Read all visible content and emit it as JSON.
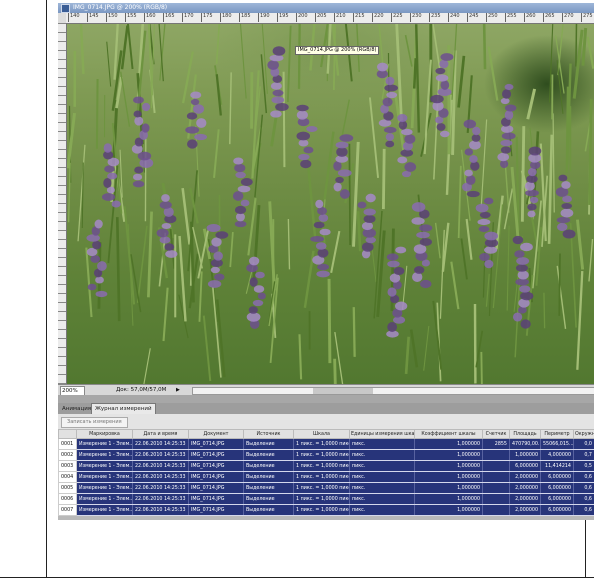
{
  "document": {
    "title": "IMG_0714.JPG @ 200% (RGB/8)",
    "tooltip": "IMG_0714.JPG @ 200% (RGB/8)",
    "ruler_ticks": [
      "140",
      "145",
      "150",
      "155",
      "160",
      "165",
      "170",
      "175",
      "180",
      "185",
      "190",
      "195",
      "200",
      "205",
      "210",
      "215",
      "220",
      "225",
      "230",
      "235",
      "240",
      "245",
      "250",
      "255",
      "260",
      "265",
      "270",
      "275"
    ]
  },
  "status_bar": {
    "zoom": "200%",
    "doc_info": "Док: 57,0M/57,0M",
    "arrow": "▶"
  },
  "panel": {
    "tabs": [
      "Анимация",
      "Журнал измерений"
    ],
    "active_tab": "Журнал измерений",
    "record_button": "Записать измерения"
  },
  "table": {
    "columns": [
      "",
      "Маркировка",
      "Дата и время",
      "Документ",
      "Источник",
      "Шкала",
      "Единицы измерения шкалы",
      "Коэффициент шкалы",
      "Счетчик",
      "Площадь",
      "Периметр",
      "Окружн"
    ],
    "rows": [
      [
        "0001",
        "Измерение 1 - Элем...",
        "22.06.2010 14:25:33",
        "IMG_0714.JPG",
        "Выделение",
        "1 пикс. = 1,0000 пикс.",
        "пикс.",
        "1,000000",
        "2855",
        "470790,00...",
        "55066,015...",
        "0,0"
      ],
      [
        "0002",
        "Измерение 1 - Элем...",
        "22.06.2010 14:25:33",
        "IMG_0714.JPG",
        "Выделение",
        "1 пикс. = 1,0000 пикс.",
        "пикс.",
        "1,000000",
        "",
        "1,000000",
        "4,000000",
        "0,7"
      ],
      [
        "0003",
        "Измерение 1 - Элем...",
        "22.06.2010 14:25:33",
        "IMG_0714.JPG",
        "Выделение",
        "1 пикс. = 1,0000 пикс.",
        "пикс.",
        "1,000000",
        "",
        "6,000000",
        "11,414214",
        "0,5"
      ],
      [
        "0004",
        "Измерение 1 - Элем...",
        "22.06.2010 14:25:33",
        "IMG_0714.JPG",
        "Выделение",
        "1 пикс. = 1,0000 пикс.",
        "пикс.",
        "1,000000",
        "",
        "2,000000",
        "6,000000",
        "0,6"
      ],
      [
        "0005",
        "Измерение 1 - Элем...",
        "22.06.2010 14:25:33",
        "IMG_0714.JPG",
        "Выделение",
        "1 пикс. = 1,0000 пикс.",
        "пикс.",
        "1,000000",
        "",
        "2,000000",
        "6,000000",
        "0,6"
      ],
      [
        "0006",
        "Измерение 1 - Элем...",
        "22.06.2010 14:25:33",
        "IMG_0714.JPG",
        "Выделение",
        "1 пикс. = 1,0000 пикс.",
        "пикс.",
        "1,000000",
        "",
        "2,000000",
        "6,000000",
        "0,6"
      ],
      [
        "0007",
        "Измерение 1 - Элем...",
        "22.06.2010 14:25:33",
        "IMG_0714.JPG",
        "Выделение",
        "1 пикс. = 1,0000 пикс.",
        "пикс.",
        "1,000000",
        "",
        "2,000000",
        "6,000000",
        "0,6"
      ]
    ]
  },
  "colors": {
    "selected_row": "#27347a",
    "title_bar": "#7a97c2",
    "flowers": "#8a6bb0",
    "foliage": "#5f8238"
  }
}
